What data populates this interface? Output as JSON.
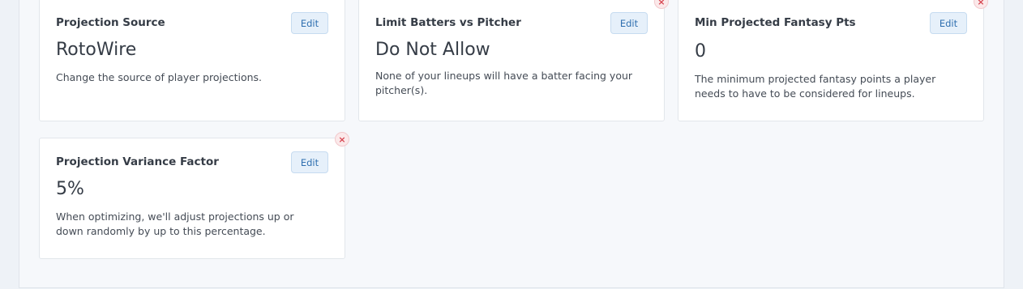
{
  "cards": [
    {
      "title": "Projection Source",
      "edit_label": "Edit",
      "value": "RotoWire",
      "description": "Change the source of player projections."
    },
    {
      "title": "Limit Batters vs Pitcher",
      "edit_label": "Edit",
      "value": "Do Not Allow",
      "description": "None of your lineups will have a batter facing your pitcher(s).",
      "remove_label": "×"
    },
    {
      "title": "Min Projected Fantasy Pts",
      "edit_label": "Edit",
      "value": "0",
      "description": "The minimum projected fantasy points a player needs to have to be considered for lineups.",
      "remove_label": "×"
    },
    {
      "title": "Projection Variance Factor",
      "edit_label": "Edit",
      "value": "5%",
      "description": "When optimizing, we'll adjust projections up or down randomly by up to this percentage.",
      "remove_label": "×"
    }
  ],
  "colors": {
    "edit_button_bg": "#e6f0fa",
    "edit_button_text": "#2f6fb0",
    "remove_button": "#d64550"
  }
}
